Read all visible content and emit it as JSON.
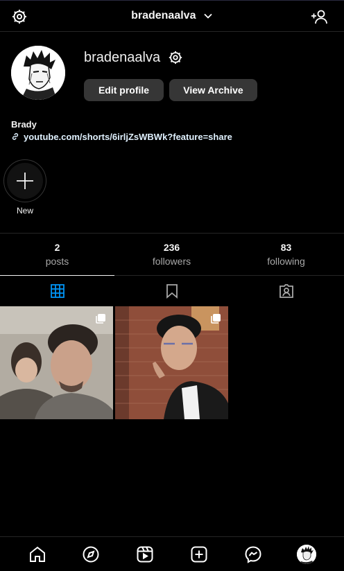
{
  "header": {
    "username": "bradenaalva",
    "settings_icon": "gear-icon",
    "dropdown_icon": "chevron-down-icon",
    "add_user_icon": "add-user-icon"
  },
  "profile": {
    "username": "bradenaalva",
    "edit_profile_label": "Edit profile",
    "view_archive_label": "View Archive",
    "bio_name": "Brady",
    "bio_link": "youtube.com/shorts/6irljZsWBWk?feature=share"
  },
  "highlights": {
    "new_label": "New"
  },
  "stats": {
    "posts_count": "2",
    "posts_label": "posts",
    "followers_count": "236",
    "followers_label": "followers",
    "following_count": "83",
    "following_label": "following"
  },
  "tabs": [
    "grid-icon",
    "saved-icon",
    "tagged-icon"
  ],
  "posts": [
    {
      "type": "carousel"
    },
    {
      "type": "carousel"
    }
  ],
  "bottom_nav": [
    "home-icon",
    "explore-icon",
    "reels-icon",
    "create-icon",
    "messenger-icon",
    "profile-avatar"
  ],
  "colors": {
    "background": "#000000",
    "button": "#363636",
    "active_tab_icon": "#0095f6",
    "link": "#e0f1ff",
    "secondary_text": "#a8a8a8"
  }
}
